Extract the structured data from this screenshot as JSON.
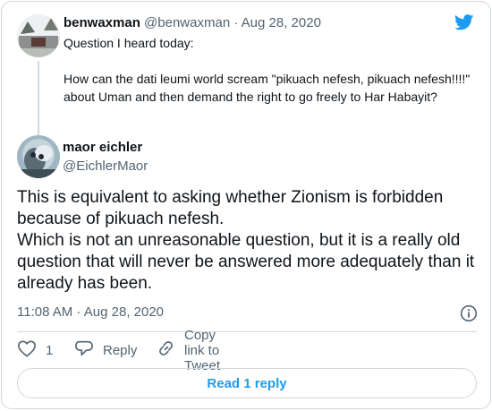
{
  "parent_tweet": {
    "display_name": "benwaxman",
    "handle": "@benwaxman",
    "separator": " · ",
    "date": "Aug 28, 2020",
    "text": "Question I heard today:\n\nHow can the dati leumi world scream \"pikuach nefesh, pikuach nefesh!!!!\" about Uman and then demand the right to go freely to Har Habayit?"
  },
  "main_tweet": {
    "display_name": "maor eichler",
    "handle": "@EichlerMaor",
    "text": "This is equivalent to asking whether Zionism is forbidden because of pikuach nefesh.\nWhich is not an unreasonable question, but it is a really old question that will never be answered more adequately than it already has been.",
    "time": "11:08 AM",
    "separator": " · ",
    "date": "Aug 28, 2020"
  },
  "actions": {
    "like_count": "1",
    "reply_label": "Reply",
    "copy_link_label": "Copy link to Tweet"
  },
  "read_replies_label": "Read 1 reply",
  "icons": {
    "brand": "twitter-bird-icon",
    "info": "info-icon",
    "like": "heart-icon",
    "reply": "speech-bubble-icon",
    "copy": "link-icon"
  },
  "colors": {
    "accent": "#1d9bf0",
    "text": "#0f1419",
    "muted": "#536471",
    "border": "#cfd9de"
  }
}
